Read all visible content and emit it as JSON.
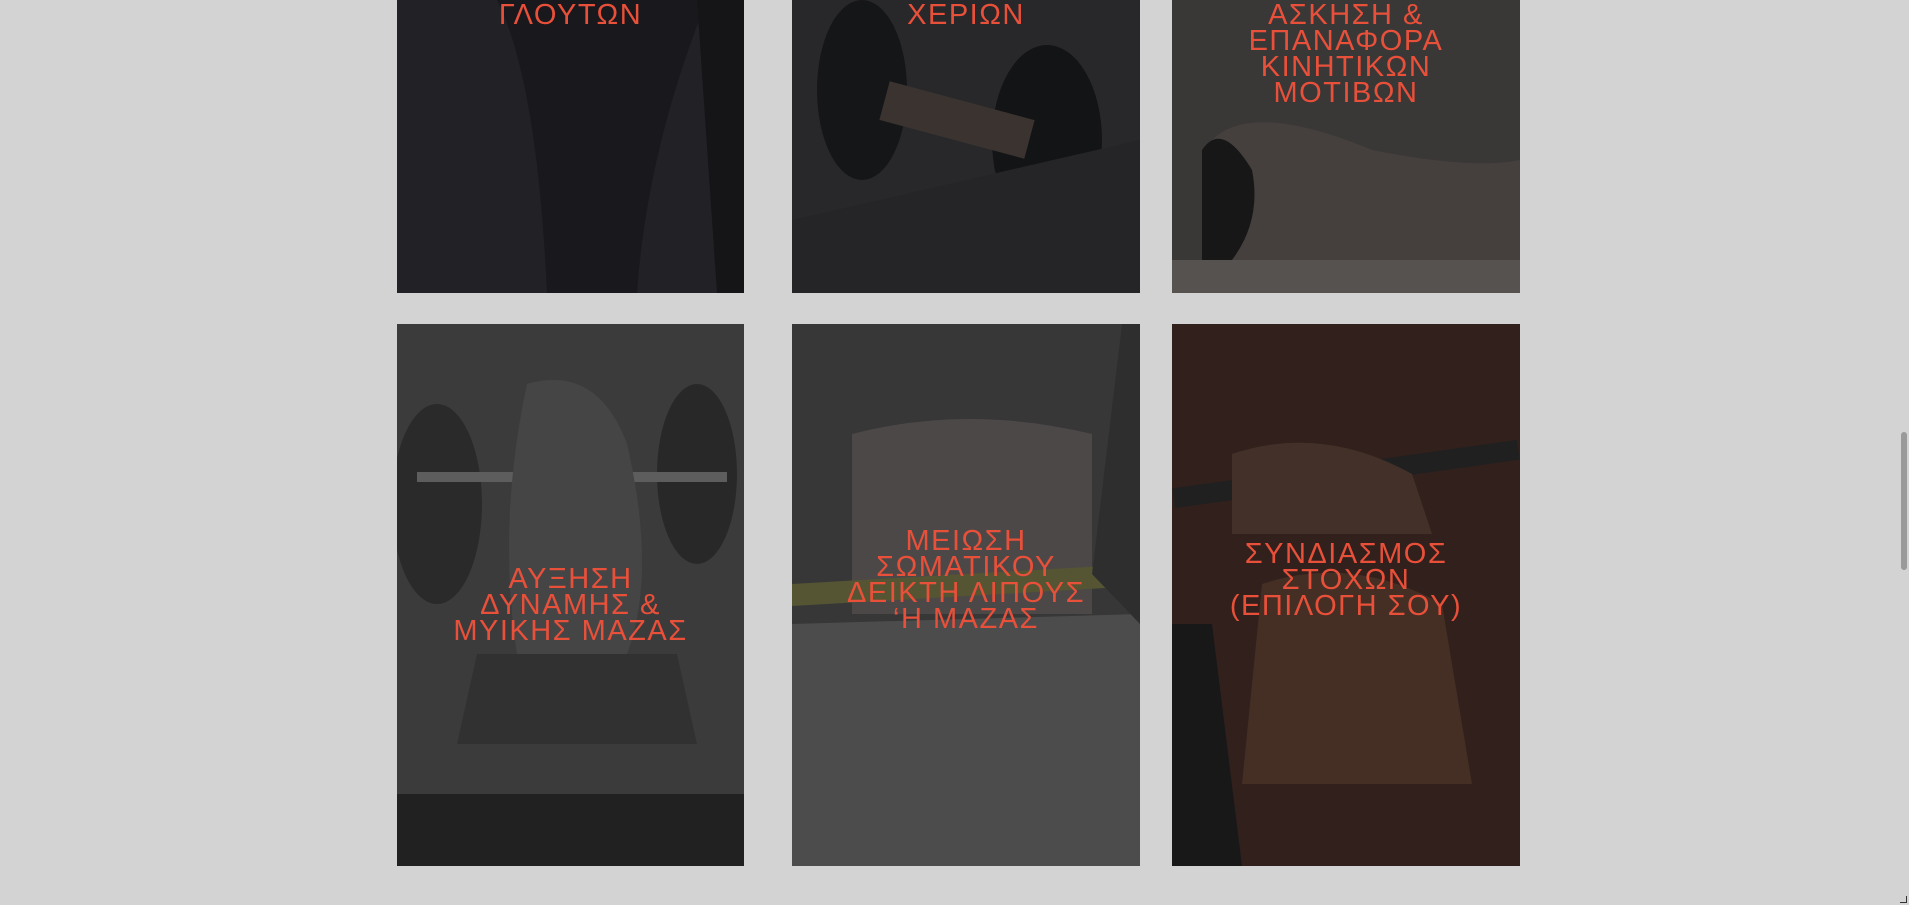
{
  "cards": [
    {
      "title": "ΓΛΟΥΤΩΝ"
    },
    {
      "title": "ΧΕΡΙΩΝ"
    },
    {
      "title": "ΑΣΚΗΣΗ &\nΕΠΑΝΑΦΟΡΑ\nΚΙΝΗΤΙΚΩΝ\nΜΟΤΙΒΩΝ"
    },
    {
      "title": "ΑΥΞΗΣΗ\nΔΥΝΑΜΗΣ &\nΜΥΙΚΗΣ ΜΑΖΑΣ"
    },
    {
      "title": "ΜΕΙΩΣΗ\nΣΩΜΑΤΙΚΟΥ\nΔΕΙΚΤΗ ΛΙΠΟΥΣ\n‘Η ΜΑΖΑΣ"
    },
    {
      "title": "ΣΥΝΔΙΑΣΜΟΣ\nΣΤΟΧΩΝ\n(ΕΠΙΛΟΓΗ ΣΟΥ)"
    }
  ],
  "colors": {
    "background": "#d3d3d3",
    "title": "#e8503a"
  }
}
